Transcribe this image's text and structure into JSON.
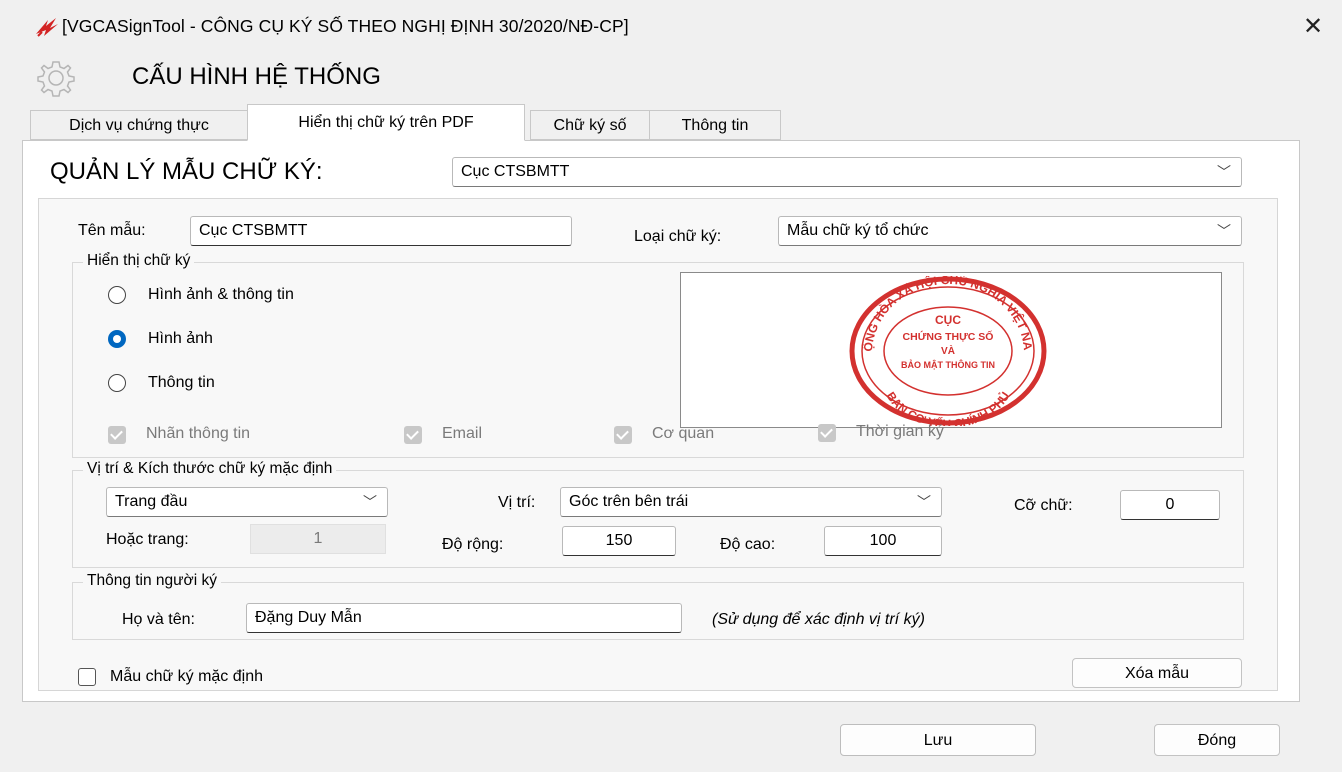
{
  "window": {
    "title": "[VGCASignTool - CÔNG CỤ KÝ SỐ THEO NGHỊ ĐỊNH 30/2020/NĐ-CP]",
    "close_glyph": "✕",
    "app_icon": "vgca-logo-icon"
  },
  "header": {
    "title": "CẤU HÌNH HỆ THỐNG",
    "icon": "gear-icon"
  },
  "tabs": [
    {
      "label": "Dịch vụ chứng thực",
      "active": false
    },
    {
      "label": "Hiển thị chữ ký trên PDF",
      "active": true
    },
    {
      "label": "Chữ ký số",
      "active": false
    },
    {
      "label": "Thông tin",
      "active": false
    }
  ],
  "template_manager": {
    "label": "QUẢN LÝ MẪU CHỮ KÝ:",
    "selected": "Cục CTSBMTT"
  },
  "template_name": {
    "label": "Tên mẫu:",
    "value": "Cục CTSBMTT"
  },
  "signature_type": {
    "label": "Loại chữ ký:",
    "selected": "Mẫu chữ ký tổ chức"
  },
  "display": {
    "legend": "Hiển thị chữ ký",
    "options": [
      {
        "label": "Hình ảnh & thông tin",
        "selected": false
      },
      {
        "label": "Hình ảnh",
        "selected": true
      },
      {
        "label": "Thông tin",
        "selected": false
      }
    ],
    "checkboxes": [
      {
        "label": "Nhãn thông tin",
        "checked": true,
        "enabled": false
      },
      {
        "label": "Email",
        "checked": true,
        "enabled": false
      },
      {
        "label": "Cơ quan",
        "checked": true,
        "enabled": false
      },
      {
        "label": "Thời gian ký",
        "checked": true,
        "enabled": false
      }
    ],
    "seal": {
      "outer_text": "CỘNG HÒA XÃ HỘI CHỦ NGHĨA VIỆT NAM",
      "bottom_text": "BAN CƠ YẾU CHÍNH PHỦ",
      "line1": "CỤC",
      "line2": "CHỨNG THỰC SỐ",
      "line3": "VÀ",
      "line4": "BẢO MẬT THÔNG TIN",
      "color": "#d3312f"
    }
  },
  "position": {
    "legend": "Vị trí  & Kích thước chữ ký mặc định",
    "page_selected": "Trang đầu",
    "position_label": "Vị trí:",
    "position_selected": "Góc trên bên trái",
    "font_size_label": "Cỡ chữ:",
    "font_size": "0",
    "or_page_label": "Hoặc trang:",
    "or_page_value": "1",
    "width_label": "Độ rộng:",
    "width": "150",
    "height_label": "Độ cao:",
    "height": "100"
  },
  "signer": {
    "legend": "Thông tin người ký",
    "name_label": "Họ và tên:",
    "name": "Đặng Duy Mẫn",
    "hint": "(Sử dụng để xác định vị trí ký)"
  },
  "default_template": {
    "label": "Mẫu chữ ký mặc định",
    "checked": false
  },
  "buttons": {
    "delete": "Xóa mẫu",
    "save": "Lưu",
    "close": "Đóng"
  },
  "colors": {
    "accent": "#0067c0",
    "seal_red": "#d3312f",
    "panel_bg": "#ffffff",
    "window_bg": "#f0f0f0"
  }
}
